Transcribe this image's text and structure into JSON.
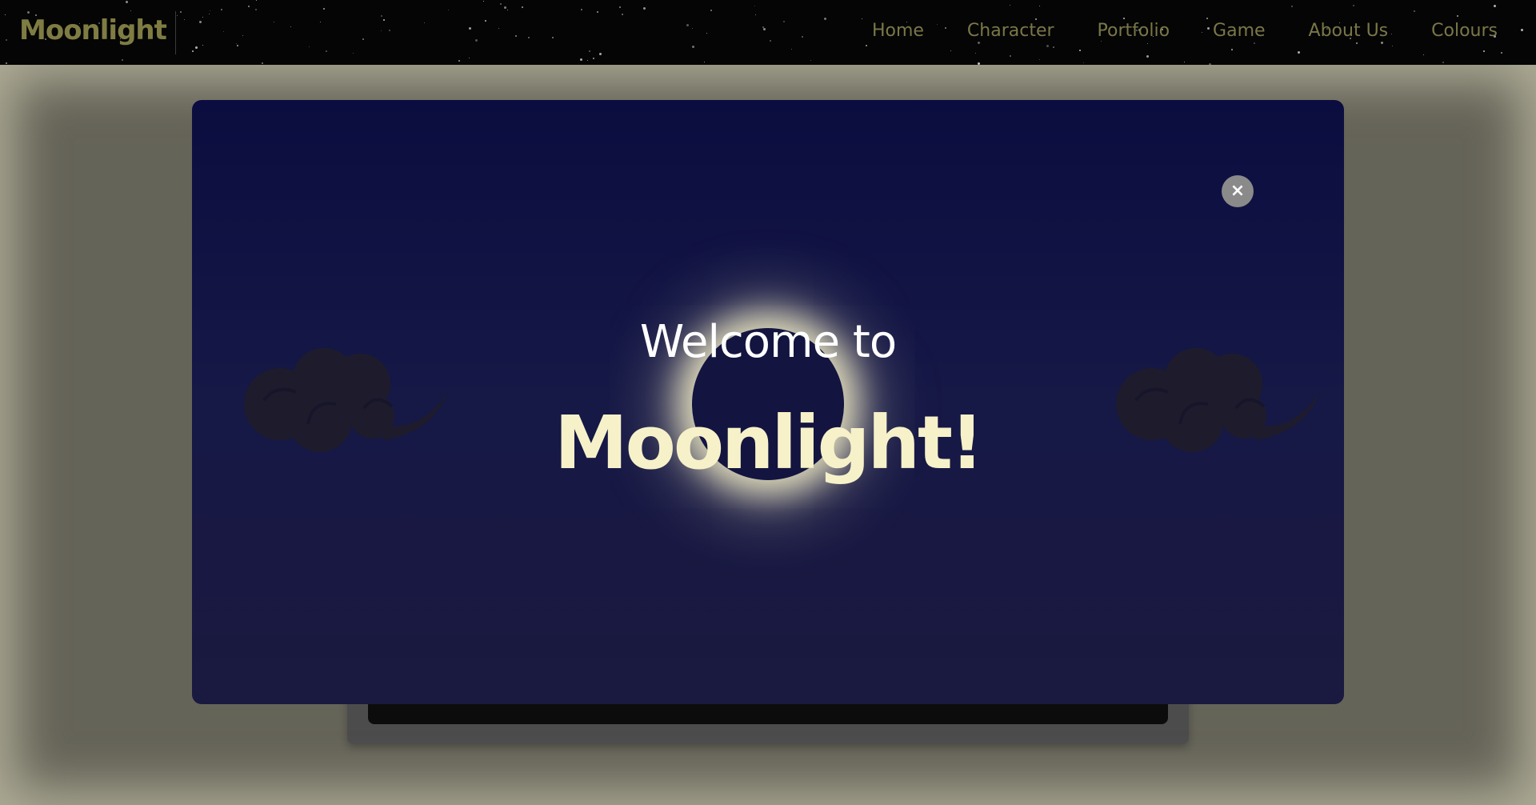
{
  "navbar": {
    "brand": "Moonlight",
    "links": [
      {
        "label": "Home"
      },
      {
        "label": "Character"
      },
      {
        "label": "Portfolio"
      },
      {
        "label": "Game"
      },
      {
        "label": "About Us"
      },
      {
        "label": "Colours"
      }
    ]
  },
  "modal": {
    "close_label": "×",
    "welcome": "Welcome to",
    "title": "Moonlight!"
  },
  "colors": {
    "brand": "#7f7c43",
    "modal_top": "#0b0d40",
    "modal_bottom": "#1a193f",
    "title": "#f6f1c9",
    "moon_glow": "#f5f0c8"
  },
  "icons": {
    "close": "close-icon",
    "cloud_left": "cloud-icon",
    "cloud_right": "cloud-icon",
    "moon": "moon-icon"
  }
}
